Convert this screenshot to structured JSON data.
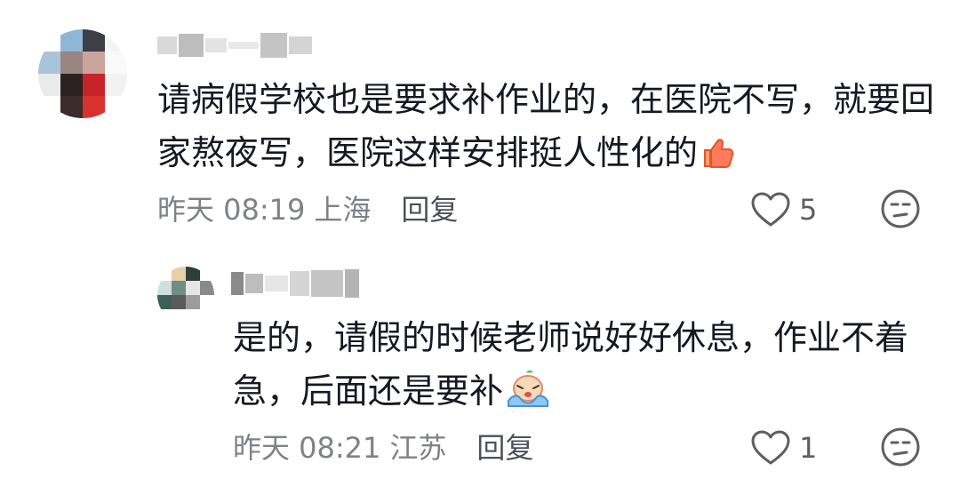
{
  "comments": [
    {
      "text": "请病假学校也是要求补作业的，在医院不写，就要回家熬夜写，医院这样安排挺人性化的",
      "emoji": "thumbs-up-icon",
      "time": "昨天 08:19",
      "location": "上海",
      "reply_label": "回复",
      "like_count": "5",
      "like_icon": "heart-outline-icon",
      "dislike_icon": "unamused-face-icon"
    },
    {
      "text": "是的，请假的时候老师说好好休息，作业不着急，后面还是要补",
      "emoji": "crying-face-icon",
      "time": "昨天 08:21",
      "location": "江苏",
      "reply_label": "回复",
      "like_count": "1",
      "like_icon": "heart-outline-icon",
      "dislike_icon": "unamused-face-icon"
    }
  ],
  "colors": {
    "text": "#161823",
    "meta": "#7f8188",
    "reply": "#4e5057",
    "icon": "#5c5e64"
  }
}
